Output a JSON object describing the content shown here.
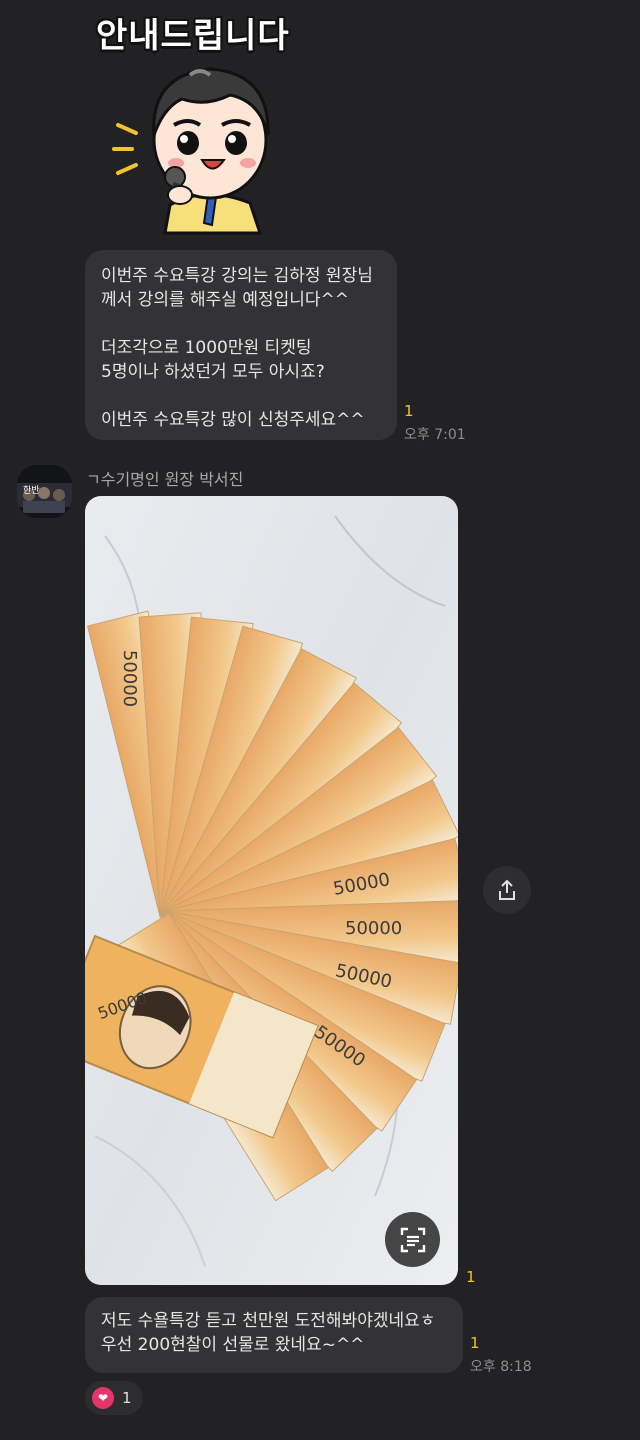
{
  "sticker": {
    "title": "안내드립니다"
  },
  "message1": {
    "text": "이번주 수요특강 강의는 김하정 원장님께서 강의를 해주실 예정입니다^^\n\n더조각으로 1000만원 티켓팅\n5명이나 하셨던거 모두 아시죠?\n\n이번주 수요특강 많이 신청주세요^^",
    "unread": "1",
    "time": "오후 7:01"
  },
  "sender": {
    "name": "ㄱ수기명인 원장 박서진",
    "avatar_label": "한반"
  },
  "photo": {
    "unread": "1",
    "note_labels": [
      "50000",
      "50000",
      "50000",
      "50000",
      "50000",
      "50000"
    ]
  },
  "message2": {
    "text": "저도 수욜특강 듣고 천만원 도전해봐야겠네요ㅎ\n우선 200현찰이 선물로 왔네요~^^",
    "unread": "1",
    "time": "오후 8:18"
  },
  "reaction": {
    "icon": "heart-icon",
    "count": "1"
  },
  "colors": {
    "background": "#222224",
    "bubble": "#333335",
    "unread": "#f2c230",
    "heart": "#e6356a"
  }
}
